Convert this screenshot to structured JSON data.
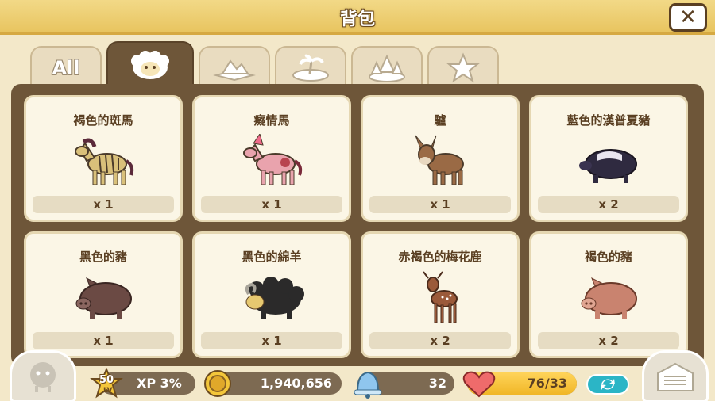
{
  "window": {
    "title": "背包",
    "close_icon": "close-icon"
  },
  "tabs": [
    {
      "id": "all",
      "label": "All",
      "icon": "all-text"
    },
    {
      "id": "animals",
      "label": "",
      "icon": "sheep-icon",
      "active": true
    },
    {
      "id": "land",
      "label": "",
      "icon": "land-icon"
    },
    {
      "id": "island",
      "label": "",
      "icon": "island-icon"
    },
    {
      "id": "trees",
      "label": "",
      "icon": "trees-icon"
    },
    {
      "id": "special",
      "label": "",
      "icon": "star-icon"
    }
  ],
  "items": [
    {
      "name": "褐色的斑馬",
      "qty": "x 1",
      "icon": "zebra-icon",
      "color": "#d9c07a"
    },
    {
      "name": "癡情馬",
      "qty": "x 1",
      "icon": "pink-horse-icon",
      "color": "#e9a3ad"
    },
    {
      "name": "驢",
      "qty": "x 1",
      "icon": "donkey-icon",
      "color": "#9a6a45"
    },
    {
      "name": "藍色的漢普夏豬",
      "qty": "x 2",
      "icon": "blue-hampshire-pig-icon",
      "color": "#2f2a40"
    },
    {
      "name": "黑色的豬",
      "qty": "x 1",
      "icon": "black-pig-icon",
      "color": "#6b4a44"
    },
    {
      "name": "黑色的綿羊",
      "qty": "x 1",
      "icon": "black-sheep-icon",
      "color": "#2b2a2a"
    },
    {
      "name": "赤褐色的梅花鹿",
      "qty": "x 2",
      "icon": "deer-icon",
      "color": "#9b5a3a"
    },
    {
      "name": "褐色的豬",
      "qty": "x 2",
      "icon": "brown-pig-icon",
      "color": "#c9836f"
    }
  ],
  "hud": {
    "level": "50",
    "level_label": "LV",
    "xp": "XP 3%",
    "coins": "1,940,656",
    "bells": "32",
    "energy": "76/33",
    "energy_fill": 1.0
  },
  "colors": {
    "title_bar": "#e8c45f",
    "panel": "#6e5639",
    "card": "#fbf6e6",
    "text_brown": "#5a3f22"
  }
}
